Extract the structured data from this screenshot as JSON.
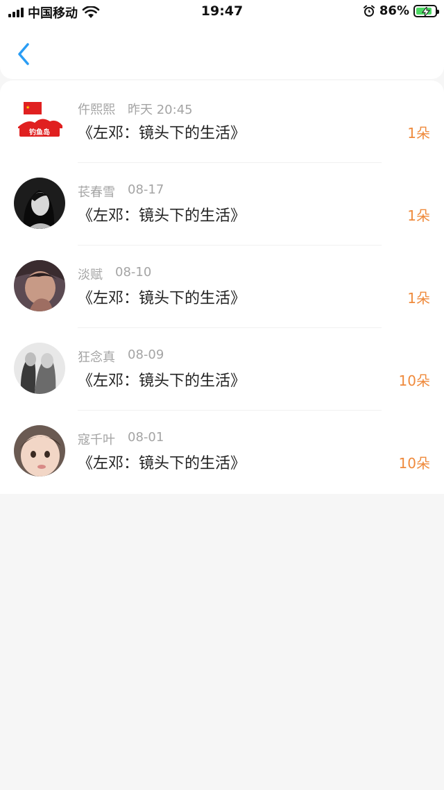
{
  "status_bar": {
    "carrier": "中国移动",
    "time": "19:47",
    "battery_percent": "86%",
    "battery_level": 0.86
  },
  "nav": {
    "back_icon": "chevron-left-icon",
    "accent": "#2a9df4"
  },
  "items": [
    {
      "user": "仵熙熙",
      "date": "昨天 20:45",
      "title": "《左邓：镜头下的生活》",
      "amount": "1朵",
      "avatar": "logo",
      "avatar_text": "钓鱼岛"
    },
    {
      "user": "苌春雪",
      "date": "08-17",
      "title": "《左邓：镜头下的生活》",
      "amount": "1朵",
      "avatar": "photo-bw-woman"
    },
    {
      "user": "淡赋",
      "date": "08-10",
      "title": "《左邓：镜头下的生活》",
      "amount": "1朵",
      "avatar": "photo-man"
    },
    {
      "user": "狂念真",
      "date": "08-09",
      "title": "《左邓：镜头下的生活》",
      "amount": "10朵",
      "avatar": "photo-couple"
    },
    {
      "user": "寇千叶",
      "date": "08-01",
      "title": "《左邓：镜头下的生活》",
      "amount": "10朵",
      "avatar": "photo-child"
    }
  ],
  "colors": {
    "amount": "#ef8a3c",
    "meta": "#a4a4a4",
    "background": "#f6f6f6"
  }
}
